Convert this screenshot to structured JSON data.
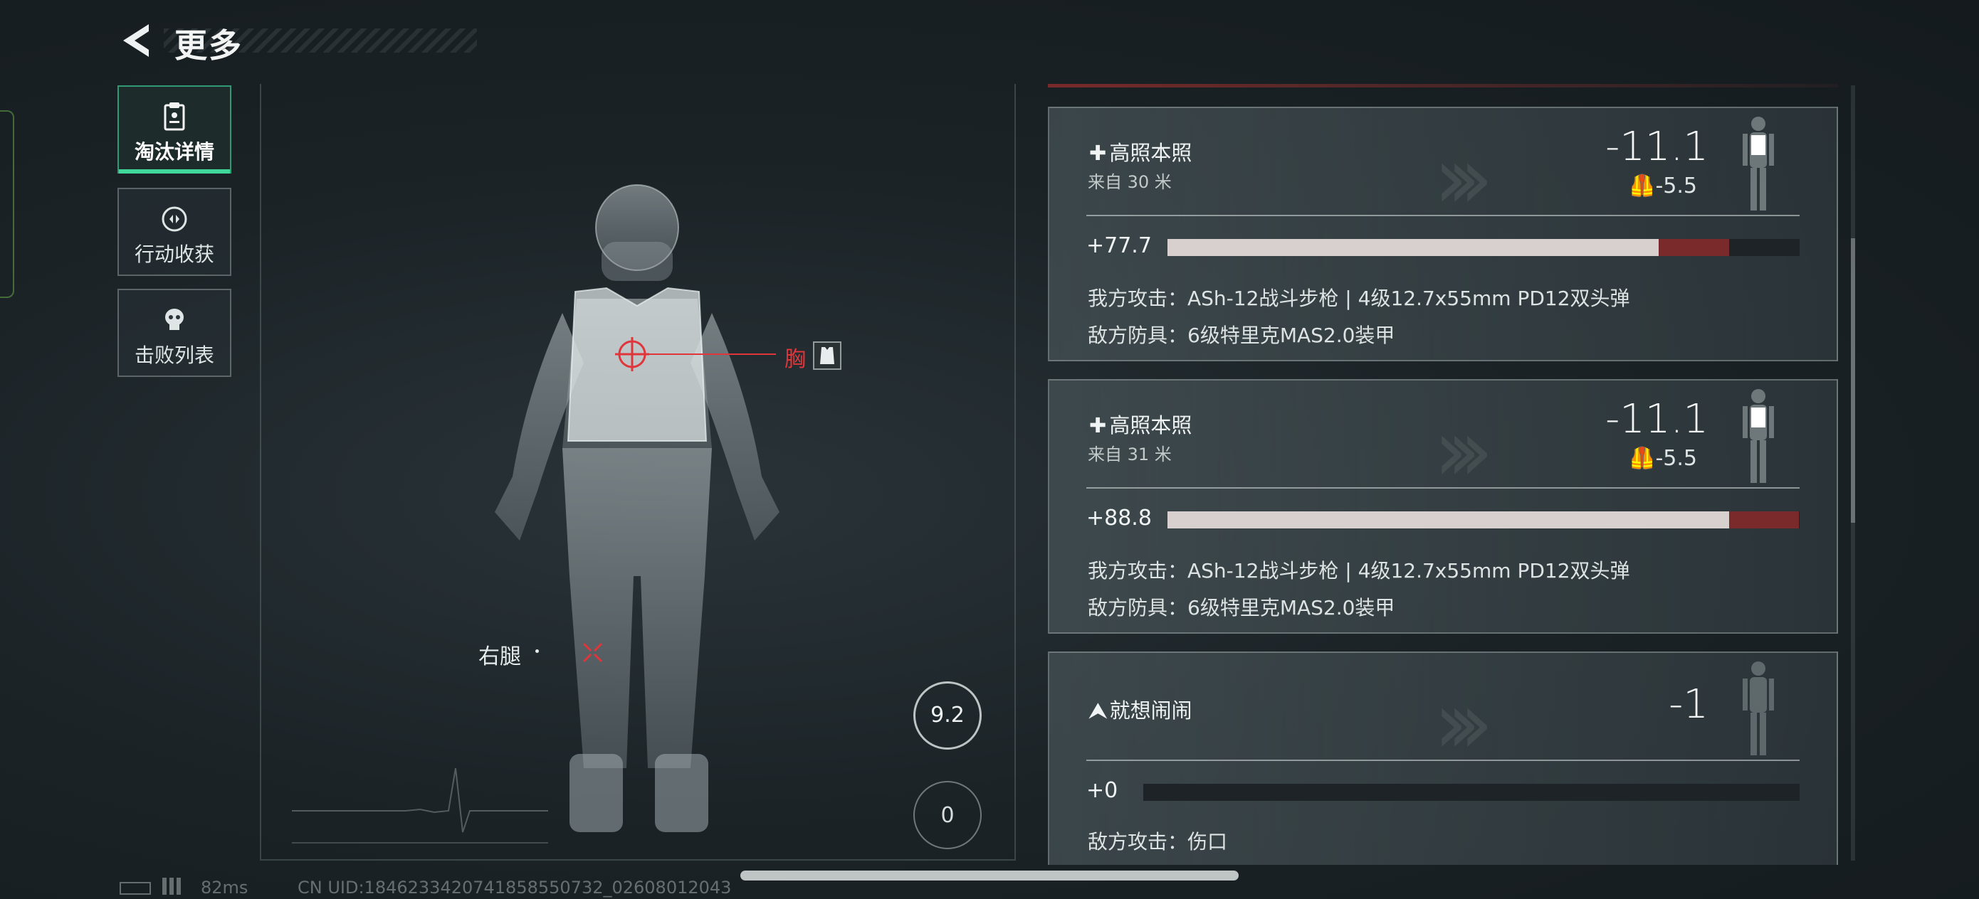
{
  "header": {
    "title": "更多"
  },
  "sidebar": {
    "items": [
      {
        "label": "淘汰详情",
        "active": true,
        "icon": "clipboard-icon"
      },
      {
        "label": "行动收获",
        "active": false,
        "icon": "loot-icon"
      },
      {
        "label": "击败列表",
        "active": false,
        "icon": "skull-icon"
      }
    ]
  },
  "figure": {
    "hit_labels": {
      "chest": "胸",
      "right_leg": "右腿"
    },
    "distance_value": "9.2",
    "kill_count": "0"
  },
  "cards": [
    {
      "icon": "plus-icon",
      "name": "高照本照",
      "distance": "来自 30 米",
      "damage": "-11.1",
      "armor_damage": "-5.5",
      "hp_label": "+77.7",
      "hp_fraction": 0.777,
      "loss_fraction": 0.111,
      "attack": "我方攻击：ASh-12战斗步枪 | 4级12.7x55mm PD12双头弹",
      "armor": "敌方防具：6级特里克MAS2.0装甲"
    },
    {
      "icon": "plus-icon",
      "name": "高照本照",
      "distance": "来自 31 米",
      "damage": "-11.1",
      "armor_damage": "-5.5",
      "hp_label": "+88.8",
      "hp_fraction": 0.888,
      "loss_fraction": 0.111,
      "attack": "我方攻击：ASh-12战斗步枪 | 4级12.7x55mm PD12双头弹",
      "armor": "敌方防具：6级特里克MAS2.0装甲"
    },
    {
      "icon": "chevron-up-icon",
      "name": "就想闹闹",
      "damage": "-1",
      "hp_label": "+0",
      "hp_fraction": 0,
      "loss_fraction": 0,
      "attack": "敌方攻击：伤口"
    }
  ],
  "footer": {
    "ping": "82ms",
    "uid": "CN UID:1846233420741858550732_02608012043"
  },
  "colors": {
    "accent": "#3fd79a",
    "damage_red": "#7a2a2a",
    "hit_red": "#e0353a"
  }
}
